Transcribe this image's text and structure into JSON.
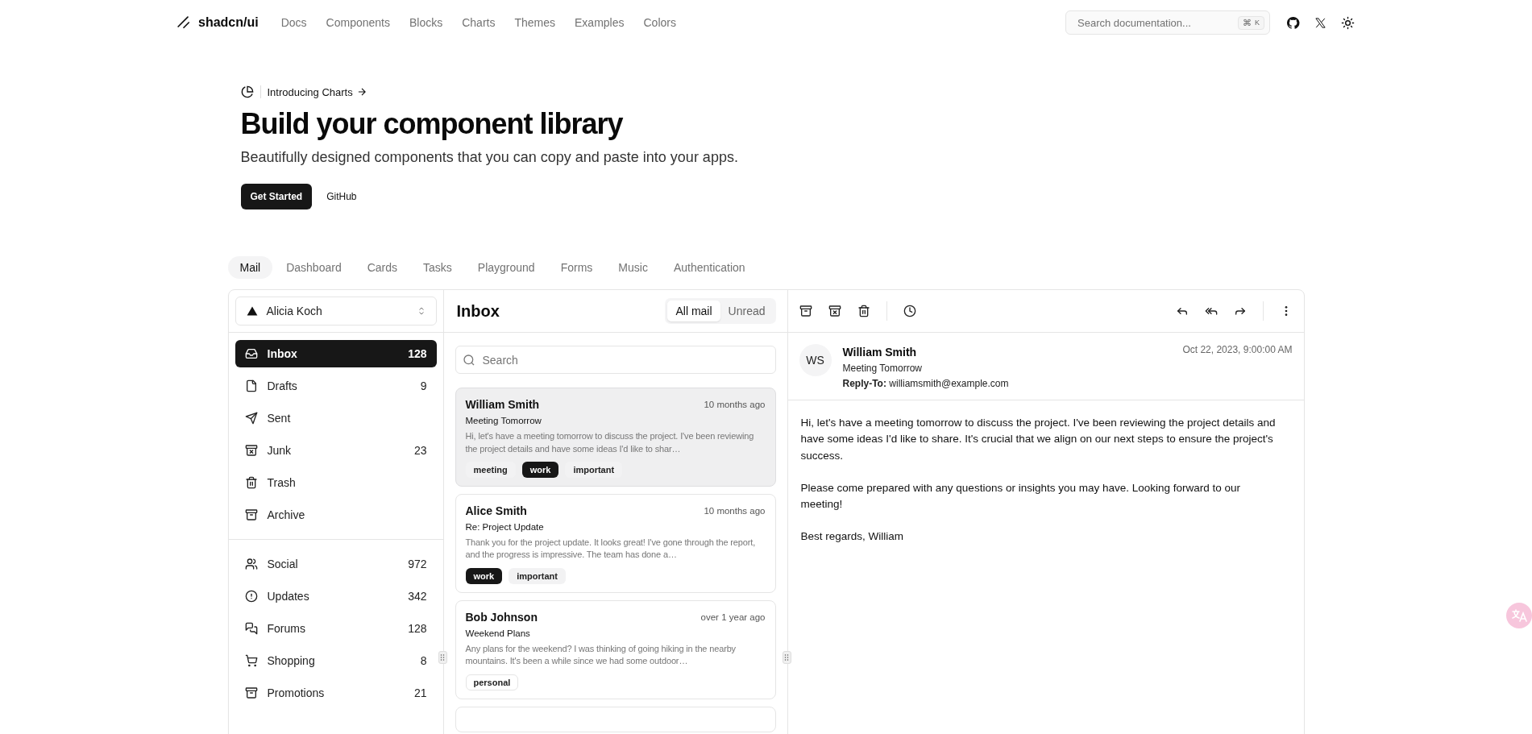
{
  "header": {
    "logo": "shadcn/ui",
    "nav": [
      {
        "label": "Docs"
      },
      {
        "label": "Components"
      },
      {
        "label": "Blocks"
      },
      {
        "label": "Charts"
      },
      {
        "label": "Themes"
      },
      {
        "label": "Examples"
      },
      {
        "label": "Colors"
      }
    ],
    "search": {
      "placeholder": "Search documentation...",
      "shortcut": [
        "⌘",
        "K"
      ]
    }
  },
  "hero": {
    "announcement": "Introducing Charts",
    "title": "Build your component library",
    "subtitle": "Beautifully designed components that you can copy and paste into your apps.",
    "buttons": [
      {
        "label": "Get Started",
        "kind": "primary"
      },
      {
        "label": "GitHub",
        "kind": "ghost"
      }
    ]
  },
  "example_tabs": [
    {
      "label": "Mail",
      "selected": true
    },
    {
      "label": "Dashboard",
      "selected": false
    },
    {
      "label": "Cards",
      "selected": false
    },
    {
      "label": "Tasks",
      "selected": false
    },
    {
      "label": "Playground",
      "selected": false
    },
    {
      "label": "Forms",
      "selected": false
    },
    {
      "label": "Music",
      "selected": false
    },
    {
      "label": "Authentication",
      "selected": false
    }
  ],
  "mail": {
    "account": "Alicia Koch",
    "folders": [
      {
        "label": "Inbox",
        "count": "128",
        "selected": true
      },
      {
        "label": "Drafts",
        "count": "9",
        "selected": false
      },
      {
        "label": "Sent",
        "selected": false
      },
      {
        "label": "Junk",
        "count": "23",
        "selected": false
      },
      {
        "label": "Trash",
        "selected": false
      },
      {
        "label": "Archive",
        "selected": false
      }
    ],
    "categories": [
      {
        "label": "Social",
        "count": "972",
        "selected": false
      },
      {
        "label": "Updates",
        "count": "342",
        "selected": false
      },
      {
        "label": "Forums",
        "count": "128",
        "selected": false
      },
      {
        "label": "Shopping",
        "count": "8",
        "selected": false
      },
      {
        "label": "Promotions",
        "count": "21",
        "selected": false
      }
    ],
    "list": {
      "title": "Inbox",
      "filters": [
        {
          "label": "All mail",
          "selected": true
        },
        {
          "label": "Unread",
          "selected": false
        }
      ],
      "search_placeholder": "Search",
      "messages": [
        {
          "name": "William Smith",
          "time": "10 months ago",
          "subject": "Meeting Tomorrow",
          "preview": "Hi, let's have a meeting tomorrow to discuss the project. I've been reviewing the project details and have some ideas I'd like to shar…",
          "selected": true,
          "tags": [
            {
              "label": "meeting",
              "kind": "secondary"
            },
            {
              "label": "work",
              "kind": "primary"
            },
            {
              "label": "important",
              "kind": "secondary"
            }
          ]
        },
        {
          "name": "Alice Smith",
          "time": "10 months ago",
          "subject": "Re: Project Update",
          "preview": "Thank you for the project update. It looks great! I've gone through the report, and the progress is impressive. The team has done a…",
          "selected": false,
          "tags": [
            {
              "label": "work",
              "kind": "primary"
            },
            {
              "label": "important",
              "kind": "secondary"
            }
          ]
        },
        {
          "name": "Bob Johnson",
          "time": "over 1 year ago",
          "subject": "Weekend Plans",
          "preview": "Any plans for the weekend? I was thinking of going hiking in the nearby mountains. It's been a while since we had some outdoor…",
          "selected": false,
          "tags": [
            {
              "label": "personal",
              "kind": "outline"
            }
          ]
        }
      ]
    },
    "reader": {
      "initials": "WS",
      "name": "William Smith",
      "subject": "Meeting Tomorrow",
      "reply_to_label": "Reply-To:",
      "reply_to": "williamsmith@example.com",
      "date": "Oct 22, 2023, 9:00:00 AM",
      "paragraphs": [
        "Hi, let's have a meeting tomorrow to discuss the project. I've been reviewing the project details and have some ideas I'd like to share. It's crucial that we align on our next steps to ensure the project's success.",
        "Please come prepared with any questions or insights you may have. Looking forward to our meeting!",
        "Best regards, William"
      ]
    }
  }
}
